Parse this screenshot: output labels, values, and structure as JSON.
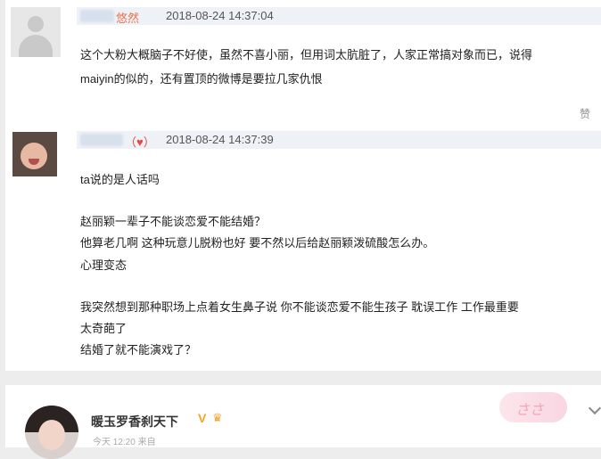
{
  "comments": [
    {
      "username_visible": "悠然",
      "timestamp": "2018-08-24 14:37:04",
      "lines": [
        "这个大粉大概脑子不好使，虽然不喜小丽，但用词太肮脏了，人家正常搞对象而已，说得",
        "maiyin的似的，还有置顶的微博是要拉几家仇恨"
      ],
      "like_label": "赞"
    },
    {
      "username_visible": "（♥）",
      "timestamp": "2018-08-24 14:37:39",
      "lines": [
        "ta说的是人话吗",
        "",
        "赵丽颖一辈子不能谈恋爱不能结婚？",
        "他算老几啊 这种玩意儿脱粉也好 要不然以后给赵丽颖泼硫酸怎么办。",
        "心理变态",
        "",
        "我突然想到那种职场上点着女生鼻子说 你不能谈恋爱不能生孩子 耽误工作 工作最重要",
        "太奇葩了",
        "结婚了就不能演戏了？"
      ]
    }
  ],
  "post": {
    "username": "暖玉罗香刹天下",
    "vip_badge": "V",
    "crown_icon": "crown-icon",
    "subline": "今天 12:20 来自",
    "sticker_text": "ささ"
  },
  "colors": {
    "accent_username": "#eb7350",
    "heart": "#e54a4a",
    "page_bg": "#ededed"
  }
}
